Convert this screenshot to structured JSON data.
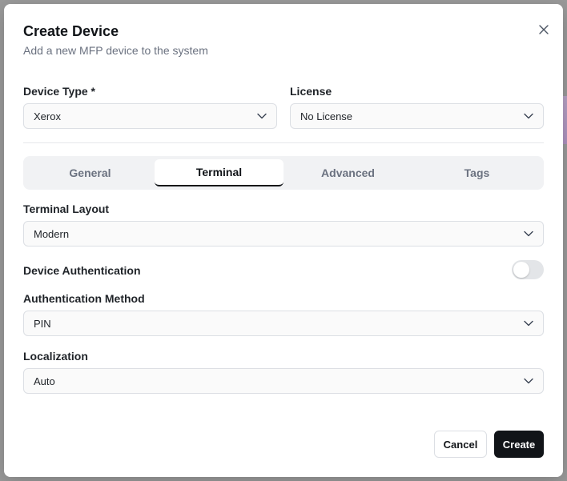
{
  "dialog": {
    "title": "Create Device",
    "subtitle": "Add a new MFP device to the system"
  },
  "fields": {
    "device_type": {
      "label": "Device Type *",
      "value": "Xerox"
    },
    "license": {
      "label": "License",
      "value": "No License"
    },
    "terminal_layout": {
      "label": "Terminal Layout",
      "value": "Modern"
    },
    "device_authentication": {
      "label": "Device Authentication",
      "enabled": false
    },
    "authentication_method": {
      "label": "Authentication Method",
      "value": "PIN"
    },
    "localization": {
      "label": "Localization",
      "value": "Auto"
    }
  },
  "tabs": [
    {
      "label": "General",
      "active": false
    },
    {
      "label": "Terminal",
      "active": true
    },
    {
      "label": "Advanced",
      "active": false
    },
    {
      "label": "Tags",
      "active": false
    }
  ],
  "buttons": {
    "cancel": "Cancel",
    "create": "Create"
  },
  "icons": {
    "close": "close-icon",
    "chevron": "chevron-down-icon"
  },
  "colors": {
    "primary_button": "#111418",
    "toggle_off": "#e3e5e8"
  }
}
